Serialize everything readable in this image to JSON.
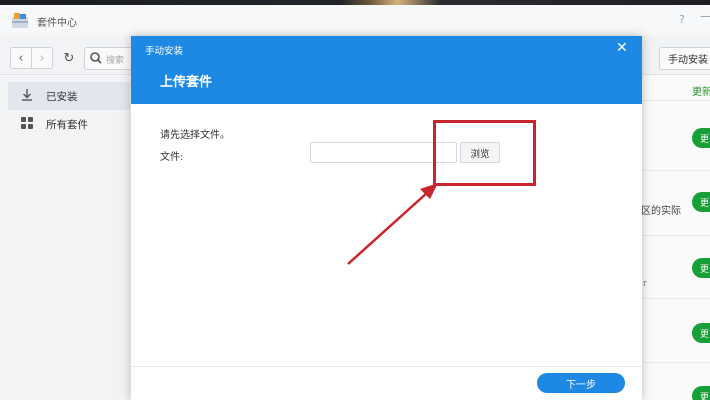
{
  "window": {
    "title": "套件中心",
    "help_icon": "?",
    "minimize_icon": "—"
  },
  "toolbar": {
    "back_icon": "‹",
    "forward_icon": "›",
    "refresh_icon": "↻",
    "search_icon": "magnifier",
    "search_placeholder": "搜索",
    "manual_install_label": "手动安装"
  },
  "sidebar": {
    "items": [
      {
        "label": "已安装",
        "icon": "download-icon",
        "active": true
      },
      {
        "label": "所有套件",
        "icon": "grid-icon",
        "active": false
      }
    ]
  },
  "background_list": {
    "column_header": "更新",
    "update_button_label": "更",
    "row_fragment_1": "区的实际",
    "row_fragment_2": "r"
  },
  "modal": {
    "title": "手动安装",
    "close_icon": "✕",
    "subtitle": "上传套件",
    "prompt": "请先选择文件。",
    "file_label": "文件:",
    "file_value": "",
    "browse_label": "浏览",
    "next_label": "下一步"
  },
  "colors": {
    "accent_blue": "#1e88e5",
    "update_green": "#19a33a",
    "annotation_red": "#c8262c"
  }
}
